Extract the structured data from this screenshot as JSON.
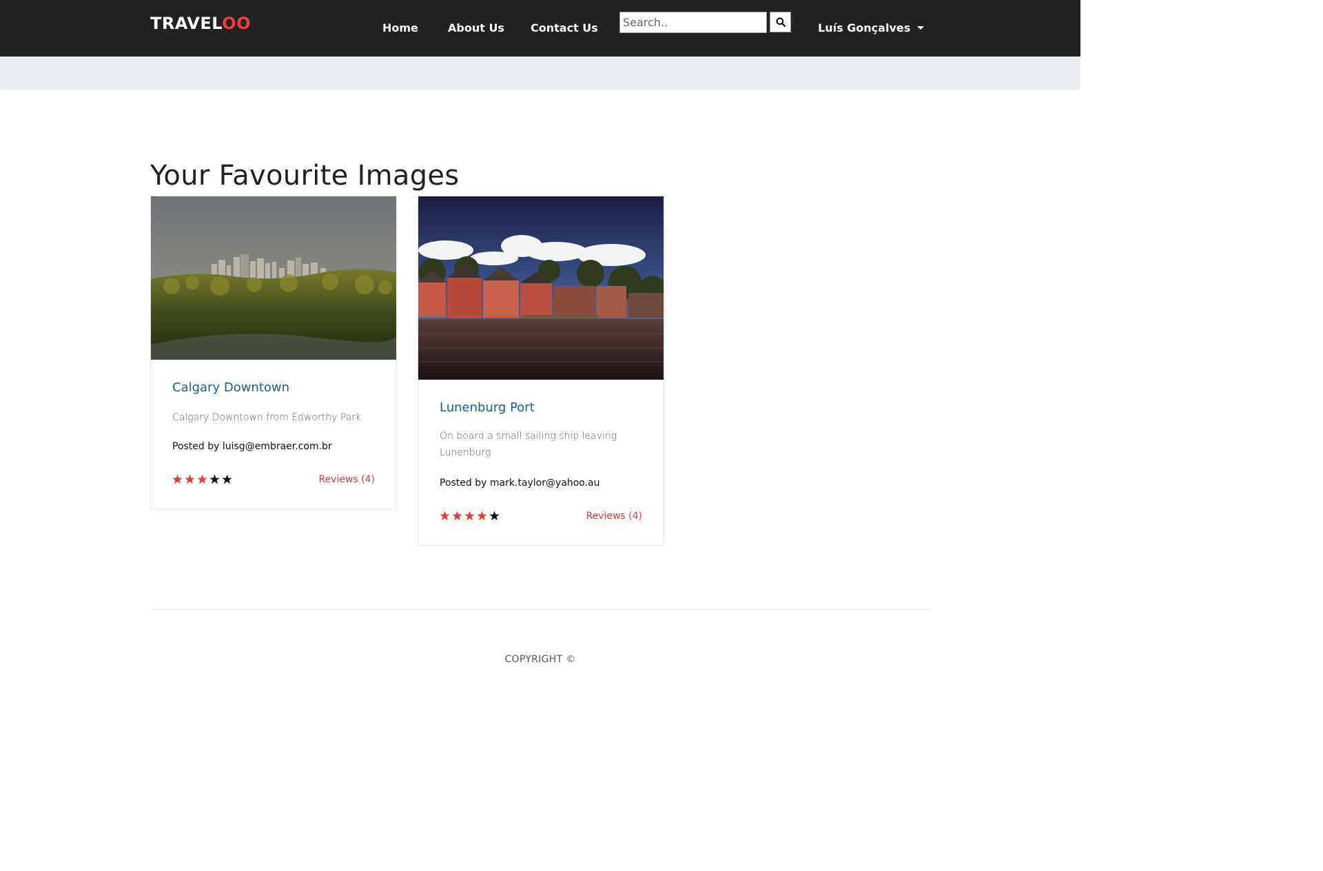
{
  "brand": {
    "part1": "TRAVEL",
    "part2": "OO",
    "accent_color": "#f03e3e"
  },
  "nav": {
    "links": [
      "Home",
      "About Us",
      "Contact Us"
    ],
    "search_placeholder": "Search..",
    "search_icon": "search-icon",
    "user_name": "Luís Gonçalves",
    "user_icon": "caret-down-icon"
  },
  "colors": {
    "navbar": "#222222",
    "subbar": "#e9ecef",
    "title_link": "#1e5b91",
    "star_active": "#e03c3c",
    "star_inactive": "#111111"
  },
  "main": {
    "title": "Your Favourite Images",
    "cards": [
      {
        "title": "Calgary Downtown",
        "description": "Calgary Downtown from Edworthy Park",
        "posted_by": "Posted by luisg@embraer.com.br",
        "rating": 3,
        "max_rating": 5,
        "reviews": "Reviews (4)"
      },
      {
        "title": "Lunenburg Port",
        "description": "On board a small sailing ship leaving Lunenburg",
        "posted_by": "Posted by mark.taylor@yahoo.au",
        "rating": 4,
        "max_rating": 5,
        "reviews": "Reviews (4)"
      }
    ]
  },
  "footer": {
    "copyright": "COPYRIGHT ©"
  }
}
